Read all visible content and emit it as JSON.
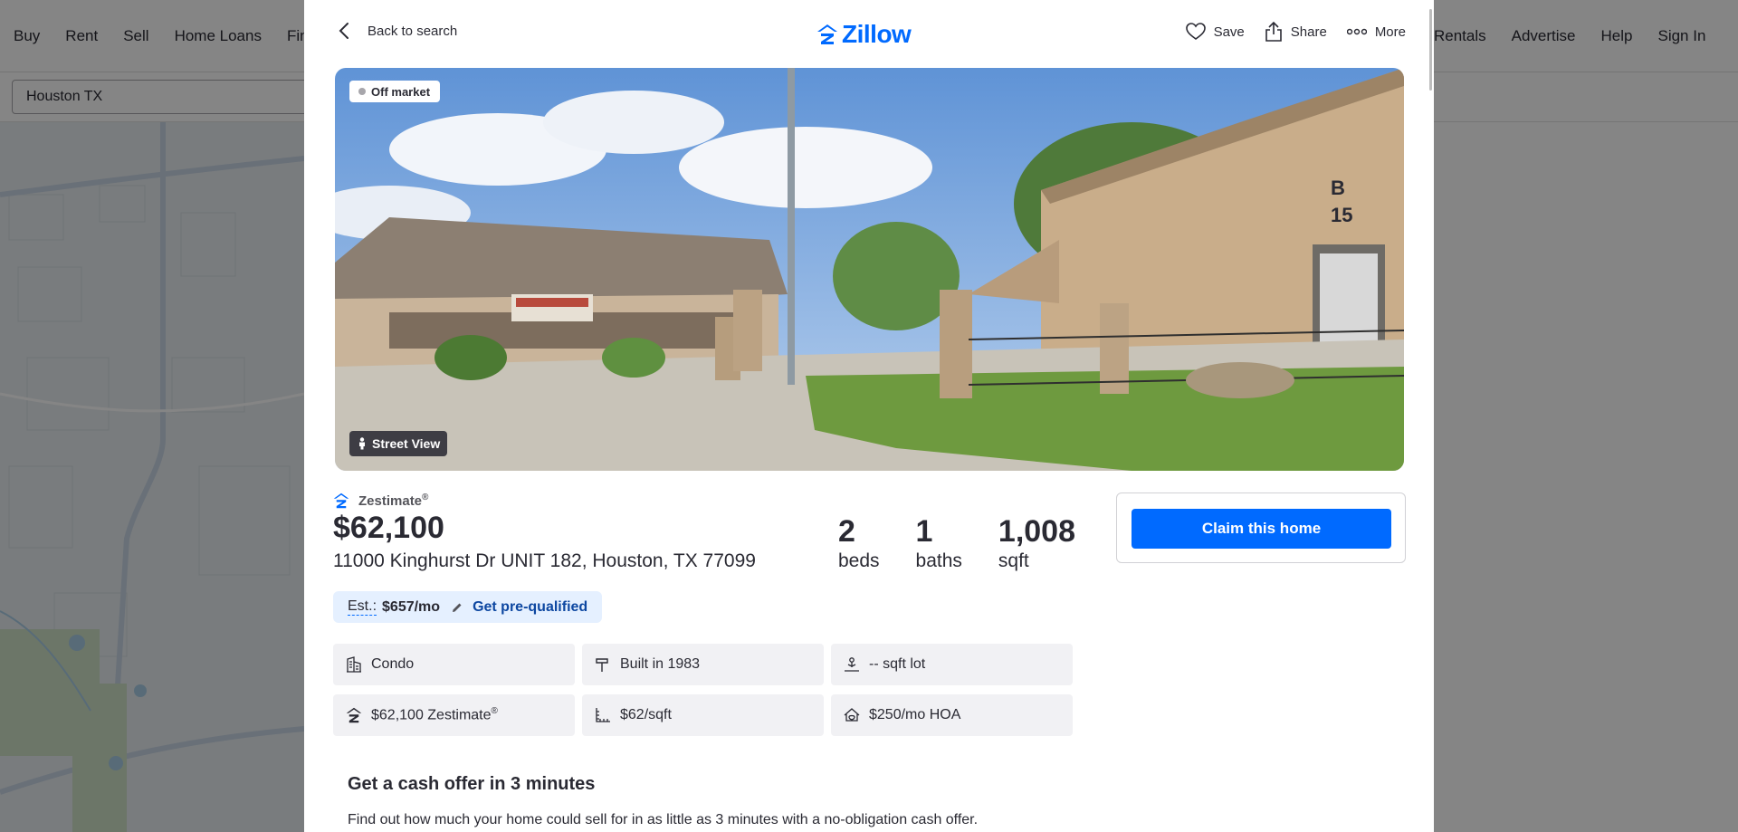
{
  "background": {
    "nav_left": [
      "Buy",
      "Rent",
      "Sell",
      "Home Loans",
      "Find"
    ],
    "nav_right": [
      "Rentals",
      "Advertise",
      "Help",
      "Sign In"
    ],
    "search_value": "Houston TX"
  },
  "header": {
    "back_label": "Back to search",
    "logo_text": "Zillow",
    "save_label": "Save",
    "share_label": "Share",
    "more_label": "More"
  },
  "photo": {
    "status_badge": "Off market",
    "street_view_label": "Street View",
    "building_sign_letter": "B",
    "building_sign_number": "15"
  },
  "summary": {
    "zestimate_label": "Zestimate",
    "zestimate_mark": "®",
    "price": "$62,100",
    "address": "11000 Kinghurst Dr UNIT 182, Houston, TX 77099",
    "beds": {
      "value": "2",
      "label": "beds"
    },
    "baths": {
      "value": "1",
      "label": "baths"
    },
    "sqft": {
      "value": "1,008",
      "label": "sqft"
    }
  },
  "claim": {
    "button_label": "Claim this home"
  },
  "estimate": {
    "label": "Est.:",
    "value": "$657/mo",
    "prequal_label": "Get pre-qualified"
  },
  "facts": [
    {
      "text": "Condo",
      "icon": "building-icon"
    },
    {
      "text": "Built in 1983",
      "icon": "hammer-icon"
    },
    {
      "text": "-- sqft lot",
      "icon": "lot-icon"
    },
    {
      "text": "$62,100 Zestimate",
      "sup": "®",
      "icon": "zestimate-icon"
    },
    {
      "text": "$62/sqft",
      "icon": "ruler-icon"
    },
    {
      "text": "$250/mo HOA",
      "icon": "hoa-icon"
    }
  ],
  "cash_offer": {
    "title": "Get a cash offer in 3 minutes",
    "description": "Find out how much your home could sell for in as little as 3 minutes with a no-obligation cash offer."
  },
  "colors": {
    "brand": "#006aff",
    "text": "#2a2a33",
    "fact_bg": "#f1f1f4",
    "estimate_bg": "#e5f0ff"
  }
}
